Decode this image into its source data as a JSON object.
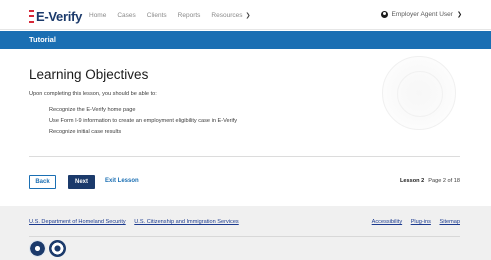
{
  "header": {
    "logo_text": "E-Verify",
    "nav": [
      "Home",
      "Cases",
      "Clients",
      "Reports",
      "Resources"
    ],
    "user_label": "Employer Agent User"
  },
  "banner": {
    "title": "Tutorial"
  },
  "content": {
    "heading": "Learning Objectives",
    "intro": "Upon completing this lesson, you should be able to:",
    "objectives": [
      "Recognize the E-Verify home page",
      "Use Form I-9 information to create an employment eligibility case in E-Verify",
      "Recognize initial case results"
    ]
  },
  "actions": {
    "back_label": "Back",
    "next_label": "Next",
    "exit_label": "Exit Lesson",
    "lesson_label": "Lesson 2",
    "page_label": "Page 2 of 18"
  },
  "footer": {
    "links_left": [
      "U.S. Department of Homeland Security",
      "U.S. Citizenship and Immigration Services"
    ],
    "links_right": [
      "Accessibility",
      "Plug-ins",
      "Sitemap"
    ]
  },
  "colors": {
    "primary_blue": "#1b6fb3",
    "navy": "#1b3a6b",
    "logo_red": "#d62839"
  },
  "icons": {
    "user": "user-circle-icon",
    "chevron": "chevron-down-icon"
  }
}
